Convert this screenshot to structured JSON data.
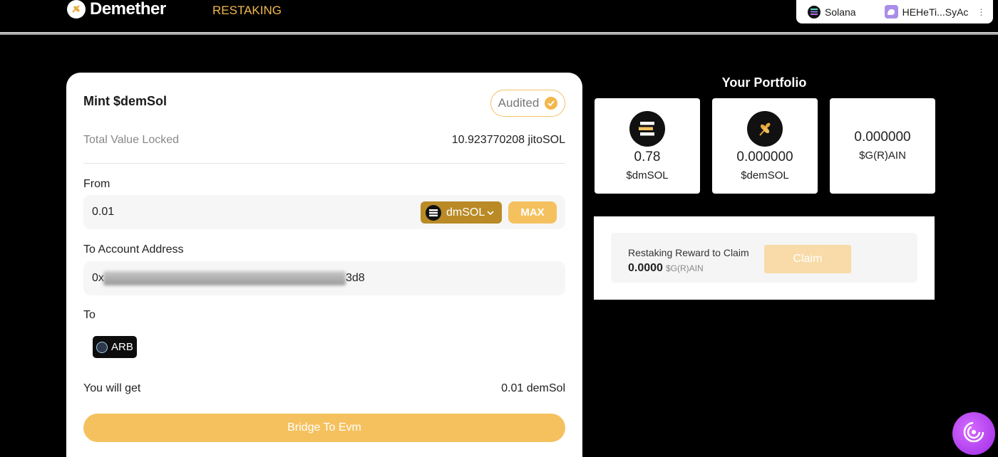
{
  "header": {
    "logo_text": "Demether",
    "nav_restaking": "RESTAKING",
    "network": "Solana",
    "wallet_address": "HEHeTi...SyAc",
    "menu_glyph": "⋮"
  },
  "mint": {
    "title": "Mint $demSol",
    "audited_label": "Audited",
    "tvl_label": "Total Value Locked",
    "tvl_value": "10.923770208 jitoSOL",
    "from_label": "From",
    "from_value": "0.01",
    "token_label": "dmSOL",
    "max_label": "MAX",
    "to_address_label": "To Account Address",
    "to_address_prefix": "0x",
    "to_address_suffix": "3d8",
    "to_label": "To",
    "chain_label": "ARB",
    "get_label": "You will get",
    "get_value": "0.01 demSol",
    "bridge_label": "Bridge To Evm"
  },
  "portfolio": {
    "title": "Your Portfolio",
    "cards": [
      {
        "value": "0.78",
        "unit": "$dmSOL",
        "icon": "solana-icon"
      },
      {
        "value": "0.000000",
        "unit": "$demSOL",
        "icon": "wheat-icon"
      },
      {
        "value": "0.000000",
        "unit": "$G(R)AIN",
        "icon": ""
      }
    ],
    "reward_label": "Restaking Reward to Claim",
    "reward_amount": "0.0000",
    "reward_unit": "$G(R)AIN",
    "claim_label": "Claim"
  },
  "colors": {
    "accent": "#f5c15e",
    "accent_dark": "#b98a26",
    "nav": "#f2b84b"
  }
}
